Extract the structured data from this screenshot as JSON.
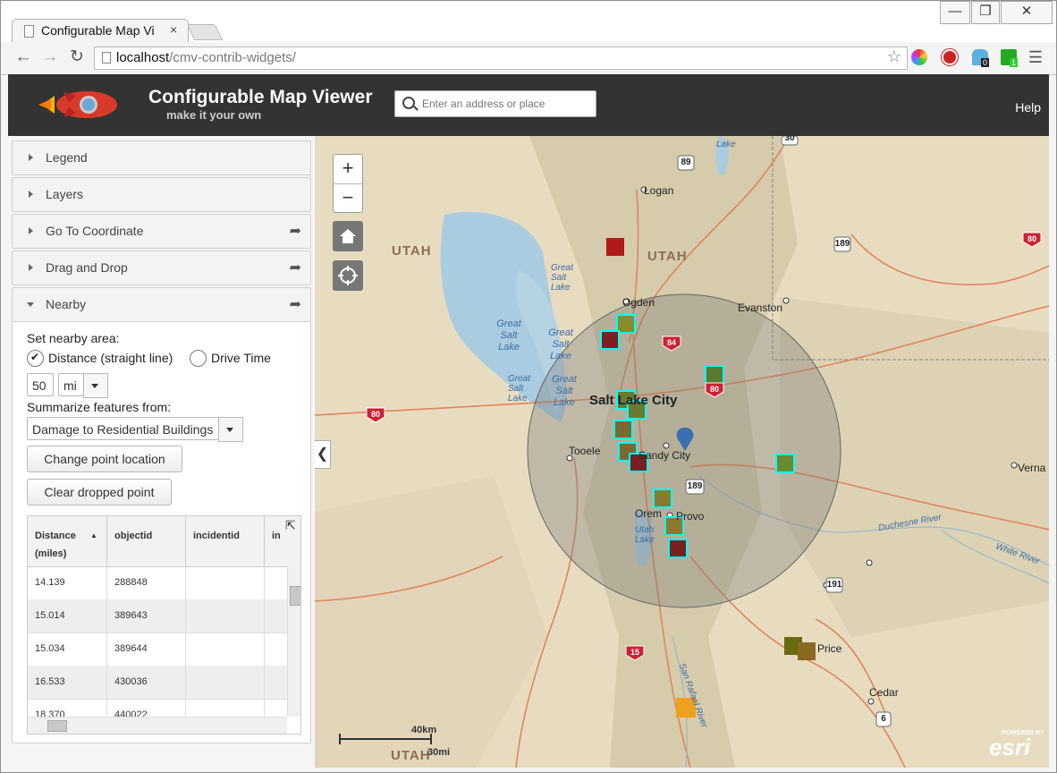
{
  "browser": {
    "tab_title": "Configurable Map Vi",
    "tab_close": "×",
    "url_host": "localhost",
    "url_path": "/cmv-contrib-widgets/",
    "win_min": "—",
    "win_max": "❐",
    "win_close": "✕",
    "ext_badge_1": "0",
    "ext_badge_2": "1"
  },
  "header": {
    "title": "Configurable Map Viewer",
    "subtitle": "make it your own",
    "search_placeholder": "Enter an address or place",
    "help": "Help"
  },
  "sidebar": {
    "panes": [
      {
        "label": "Legend"
      },
      {
        "label": "Layers"
      },
      {
        "label": "Go To Coordinate"
      },
      {
        "label": "Drag and Drop"
      },
      {
        "label": "Nearby"
      }
    ],
    "nearby": {
      "set_area_label": "Set nearby area:",
      "option_distance": "Distance (straight line)",
      "option_drive": "Drive Time",
      "distance_value": "50",
      "unit": "mi",
      "summarize_label": "Summarize features from:",
      "layer": "Damage to Residential Buildings",
      "change_button": "Change point location",
      "clear_button": "Clear dropped point"
    },
    "table": {
      "headers": [
        "Distance (miles)",
        "objectid",
        "incidentid",
        "in"
      ],
      "rows": [
        [
          "14.139",
          "288848"
        ],
        [
          "15.014",
          "389643"
        ],
        [
          "15.034",
          "389644"
        ],
        [
          "16.533",
          "430036"
        ],
        [
          "18.370",
          "440022"
        ]
      ]
    }
  },
  "map": {
    "labels": {
      "utah1": "UTAH",
      "utah2": "UTAH",
      "utah3": "UTAH",
      "logan": "Logan",
      "ogden": "Ogden",
      "evanston": "Evanston",
      "slc": "Salt Lake City",
      "tooele": "Tooele",
      "sandy": "Sandy City",
      "orem": "Orem",
      "provo": "Provo",
      "price": "Price",
      "cedar": "Cedar",
      "vernal": "Verna",
      "gsl1": "Great Salt Lake",
      "gsl2": "Great Salt Lake",
      "gsl3": "Great Salt Lake",
      "gsl4": "Great Salt Lake",
      "gsl5": "Great Salt Lake",
      "utahlake": "Utah Lake",
      "bearlake": "Lake",
      "duchesne": "Duchesne River",
      "white": "White River",
      "sanrafael": "San Rafael River",
      "scale_km": "40km",
      "scale_mi": "30mi",
      "powered": "POWERED BY",
      "esri": "esri"
    },
    "shields": {
      "i80a": "80",
      "i80b": "80",
      "i80c": "80",
      "i84": "84",
      "i15": "15",
      "us89": "89",
      "us189a": "189",
      "us189b": "189",
      "us191": "191",
      "us6": "6",
      "us30": "30"
    }
  }
}
